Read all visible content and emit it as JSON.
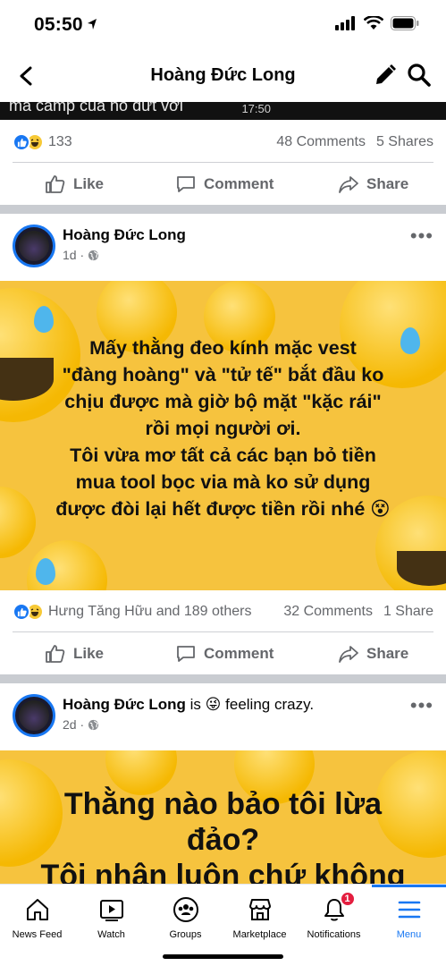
{
  "status_bar": {
    "time": "05:50"
  },
  "nav": {
    "title": "Hoàng Đức Long"
  },
  "prev_post": {
    "caption": "mà camp của nó dứt với",
    "video_time": "17:50",
    "reactions_count": "133",
    "comments": "48 Comments",
    "shares": "5 Shares"
  },
  "actions": {
    "like": "Like",
    "comment": "Comment",
    "share": "Share"
  },
  "post1": {
    "author": "Hoàng Đức Long",
    "time": "1d ·",
    "text_lines": [
      "Mấy thằng đeo kính mặc vest",
      "\"đàng hoàng\" và \"tử tế\" bắt đầu ko",
      "chịu được mà giờ bộ mặt \"kặc rái\"",
      "rồi mọi người ơi.",
      "Tôi vừa mơ tất cả các bạn bỏ tiền",
      "mua tool bọc via mà ko sử dụng",
      "được đòi lại hết được tiền rồi nhé 😵"
    ],
    "reactions_text": "Hưng Tăng Hữu and 189 others",
    "comments": "32 Comments",
    "shares": "1 Share"
  },
  "post2": {
    "author": "Hoàng Đức Long",
    "feeling_prefix": "is",
    "feeling_emoji": "😜",
    "feeling_text": "feeling crazy.",
    "time": "2d ·",
    "text_lines": [
      "Thằng nào bảo tôi lừa",
      "đảo?",
      "Tôi nhận luôn chứ không"
    ]
  },
  "tabs": [
    {
      "label": "News Feed",
      "icon": "home-icon"
    },
    {
      "label": "Watch",
      "icon": "watch-icon"
    },
    {
      "label": "Groups",
      "icon": "groups-icon"
    },
    {
      "label": "Marketplace",
      "icon": "marketplace-icon"
    },
    {
      "label": "Notifications",
      "icon": "bell-icon",
      "badge": "1"
    },
    {
      "label": "Menu",
      "icon": "menu-icon",
      "active": true
    }
  ],
  "colors": {
    "accent": "#1877f2",
    "post_bg": "#f6c33e",
    "badge": "#e41e3f"
  }
}
